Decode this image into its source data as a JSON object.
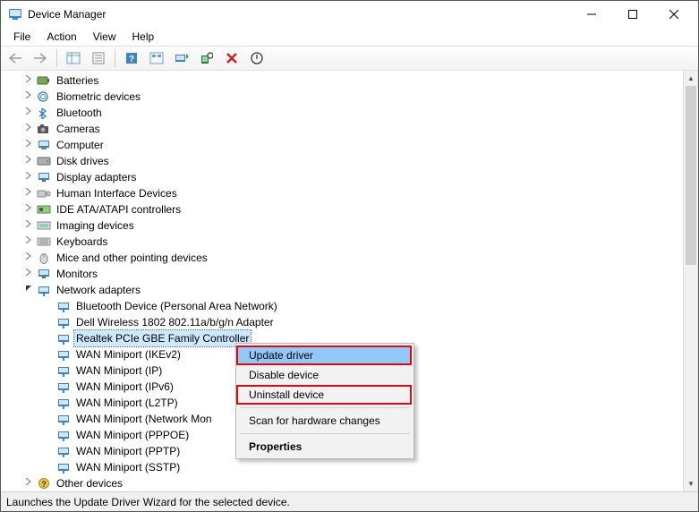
{
  "window": {
    "title": "Device Manager"
  },
  "menu": {
    "file": "File",
    "action": "Action",
    "view": "View",
    "help": "Help"
  },
  "tree": {
    "categories": [
      {
        "icon": "battery",
        "label": "Batteries"
      },
      {
        "icon": "biometric",
        "label": "Biometric devices"
      },
      {
        "icon": "bluetooth",
        "label": "Bluetooth"
      },
      {
        "icon": "camera",
        "label": "Cameras"
      },
      {
        "icon": "computer",
        "label": "Computer"
      },
      {
        "icon": "disk",
        "label": "Disk drives"
      },
      {
        "icon": "display",
        "label": "Display adapters"
      },
      {
        "icon": "hid",
        "label": "Human Interface Devices"
      },
      {
        "icon": "ide",
        "label": "IDE ATA/ATAPI controllers"
      },
      {
        "icon": "imaging",
        "label": "Imaging devices"
      },
      {
        "icon": "keyboard",
        "label": "Keyboards"
      },
      {
        "icon": "mouse",
        "label": "Mice and other pointing devices"
      },
      {
        "icon": "monitor",
        "label": "Monitors"
      }
    ],
    "network_category": {
      "label": "Network adapters"
    },
    "network_children": [
      {
        "label": "Bluetooth Device (Personal Area Network)"
      },
      {
        "label": "Dell Wireless 1802 802.11a/b/g/n Adapter"
      },
      {
        "label": "Realtek PCIe GBE Family Controller",
        "selected": true
      },
      {
        "label": "WAN Miniport (IKEv2)"
      },
      {
        "label": "WAN Miniport (IP)"
      },
      {
        "label": "WAN Miniport (IPv6)"
      },
      {
        "label": "WAN Miniport (L2TP)"
      },
      {
        "label": "WAN Miniport (Network Mon"
      },
      {
        "label": "WAN Miniport (PPPOE)"
      },
      {
        "label": "WAN Miniport (PPTP)"
      },
      {
        "label": "WAN Miniport (SSTP)"
      }
    ],
    "trailing_category": {
      "label": "Other devices"
    }
  },
  "context_menu": {
    "update": "Update driver",
    "disable": "Disable device",
    "uninstall": "Uninstall device",
    "scan": "Scan for hardware changes",
    "properties": "Properties"
  },
  "statusbar": {
    "text": "Launches the Update Driver Wizard for the selected device."
  }
}
